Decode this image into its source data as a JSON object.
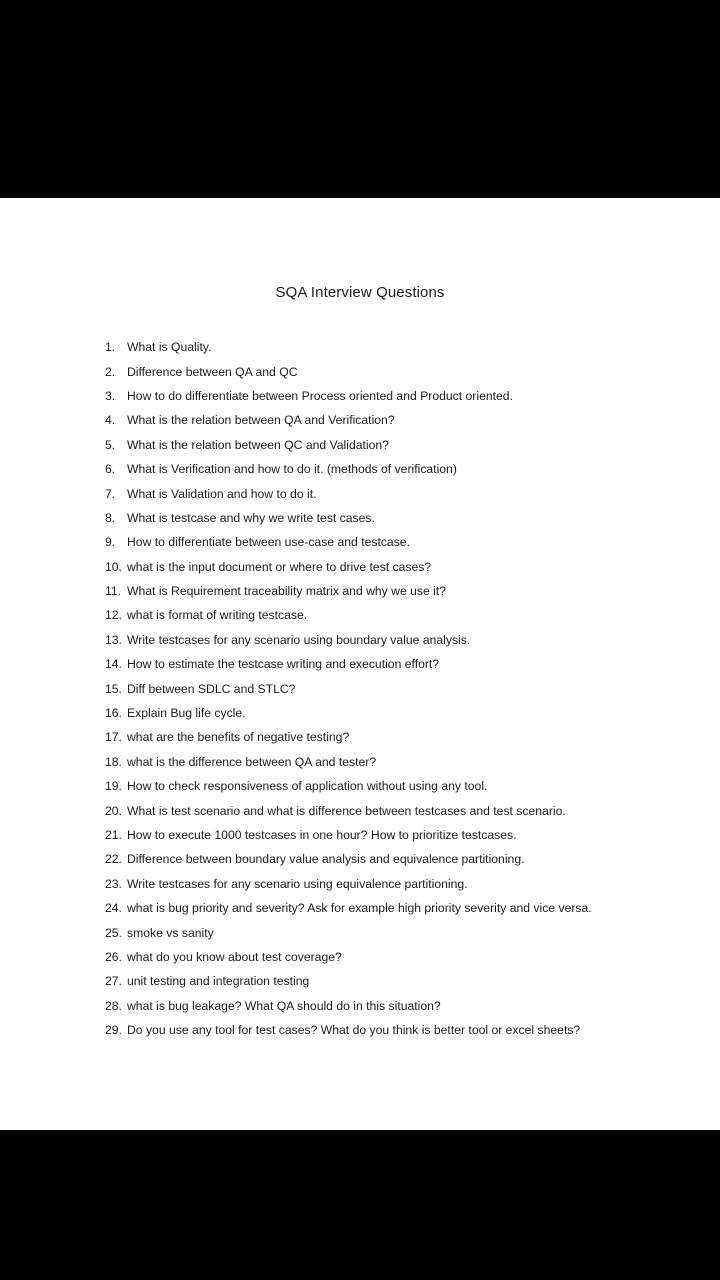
{
  "document": {
    "title": "SQA Interview Questions",
    "questions": [
      {
        "num": "1.",
        "text": "What is Quality."
      },
      {
        "num": "2.",
        "text": "Difference between QA and QC"
      },
      {
        "num": "3.",
        "text": "How to do differentiate between Process oriented and Product oriented."
      },
      {
        "num": "4.",
        "text": "What is the relation between QA and Verification?"
      },
      {
        "num": "5.",
        "text": "What is the relation between QC and Validation?"
      },
      {
        "num": "6.",
        "text": "What is Verification and how to do it. (methods of verification)"
      },
      {
        "num": "7.",
        "text": "What is Validation and how to do it."
      },
      {
        "num": "8.",
        "text": "What is testcase and why we write test cases."
      },
      {
        "num": "9.",
        "text": "How to differentiate between use-case and testcase."
      },
      {
        "num": "10.",
        "text": "what is the input document or where to drive test cases?"
      },
      {
        "num": "11.",
        "text": "What is Requirement traceability matrix and why we use it?"
      },
      {
        "num": "12.",
        "text": "what is format of writing testcase."
      },
      {
        "num": "13.",
        "text": "Write testcases for any scenario using boundary value analysis."
      },
      {
        "num": "14.",
        "text": "How to estimate the testcase writing and execution effort?"
      },
      {
        "num": "15.",
        "text": "Diff between SDLC and STLC?"
      },
      {
        "num": "16.",
        "text": "Explain Bug life cycle."
      },
      {
        "num": "17.",
        "text": "what are the benefits of negative testing?"
      },
      {
        "num": "18.",
        "text": "what is the difference between QA and tester?"
      },
      {
        "num": "19.",
        "text": "How to check responsiveness of application without using any tool."
      },
      {
        "num": "20.",
        "text": "What is test scenario and what is difference between testcases and test scenario."
      },
      {
        "num": "21.",
        "text": "How to execute 1000 testcases in one hour? How to prioritize testcases."
      },
      {
        "num": "22.",
        "text": "Difference between boundary value analysis and equivalence partitioning."
      },
      {
        "num": "23.",
        "text": "Write testcases for any scenario using equivalence partitioning."
      },
      {
        "num": "24.",
        "text": "what is bug priority and severity? Ask for example high priority severity and vice versa."
      },
      {
        "num": "25.",
        "text": "smoke vs sanity"
      },
      {
        "num": "26.",
        "text": "what do you know about test coverage?"
      },
      {
        "num": "27.",
        "text": "unit testing and integration testing"
      },
      {
        "num": "28.",
        "text": "what is bug leakage? What QA should do in this situation?"
      },
      {
        "num": "29.",
        "text": "Do you use any tool for test cases? What do you think is better tool or excel sheets?"
      }
    ]
  }
}
